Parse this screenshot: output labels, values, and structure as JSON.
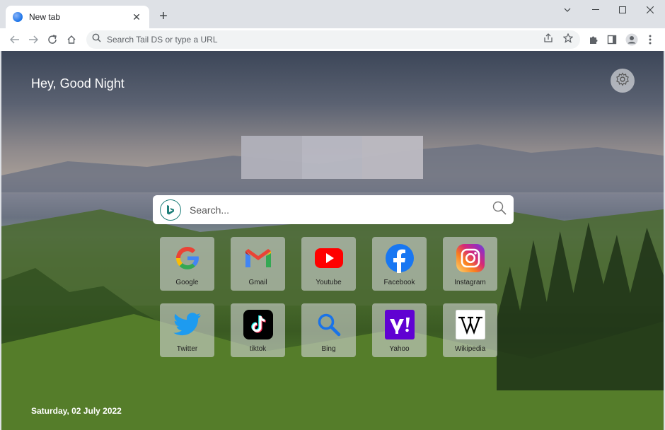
{
  "browser": {
    "tab_title": "New tab",
    "new_tab_symbol": "+",
    "close_symbol": "✕",
    "omnibox_placeholder": "Search Tail DS or type a URL",
    "window_controls": [
      "minimize-icon",
      "maximize-icon",
      "close-icon"
    ]
  },
  "page": {
    "greeting": "Hey, Good Night",
    "search_placeholder": "Search...",
    "date": "Saturday, 02 July 2022"
  },
  "tiles": [
    {
      "label": "Google",
      "icon": "google-icon"
    },
    {
      "label": "Gmail",
      "icon": "gmail-icon"
    },
    {
      "label": "Youtube",
      "icon": "youtube-icon"
    },
    {
      "label": "Facebook",
      "icon": "facebook-icon"
    },
    {
      "label": "Instagram",
      "icon": "instagram-icon"
    },
    {
      "label": "Twitter",
      "icon": "twitter-icon"
    },
    {
      "label": "tiktok",
      "icon": "tiktok-icon"
    },
    {
      "label": "Bing",
      "icon": "bing-search-icon"
    },
    {
      "label": "Yahoo",
      "icon": "yahoo-icon"
    },
    {
      "label": "Wikipedia",
      "icon": "wikipedia-icon"
    }
  ],
  "colors": {
    "tabstrip": "#dee1e6",
    "google_blue": "#4285f4",
    "youtube_red": "#ff0000",
    "facebook_blue": "#1877f2",
    "twitter_blue": "#1d9bf0",
    "yahoo_purple": "#6001d2",
    "bing_teal": "#1f7f7a"
  }
}
